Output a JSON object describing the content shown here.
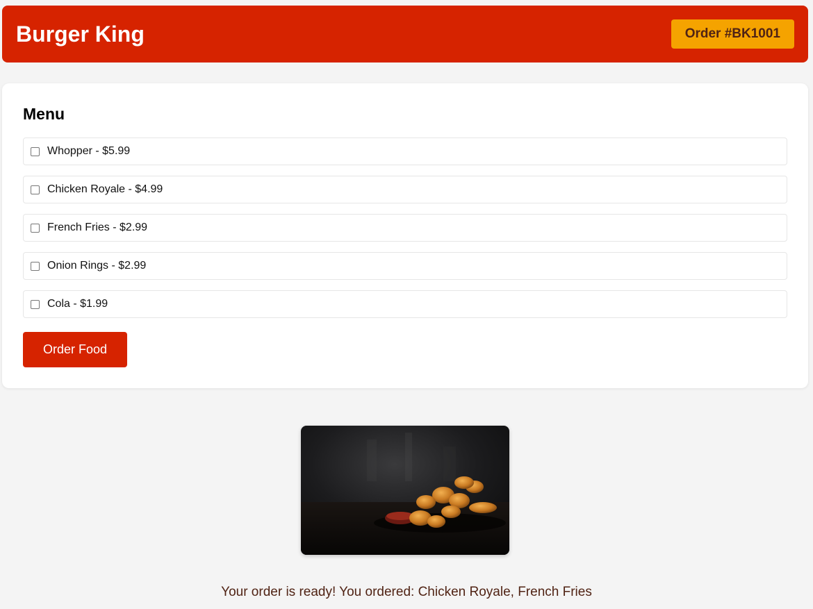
{
  "header": {
    "brand": "Burger King",
    "order_id": "Order #BK1001"
  },
  "menu": {
    "title": "Menu",
    "items": [
      {
        "label": "Whopper - $5.99",
        "checked": false
      },
      {
        "label": "Chicken Royale - $4.99",
        "checked": false
      },
      {
        "label": "French Fries - $2.99",
        "checked": false
      },
      {
        "label": "Onion Rings - $2.99",
        "checked": false
      },
      {
        "label": "Cola - $1.99",
        "checked": false
      }
    ],
    "order_button": "Order Food"
  },
  "status": {
    "message": "Your order is ready! You ordered: Chicken Royale, French Fries"
  },
  "colors": {
    "brand_red": "#d62300",
    "badge_yellow": "#f5a300",
    "brown_text": "#502314"
  }
}
